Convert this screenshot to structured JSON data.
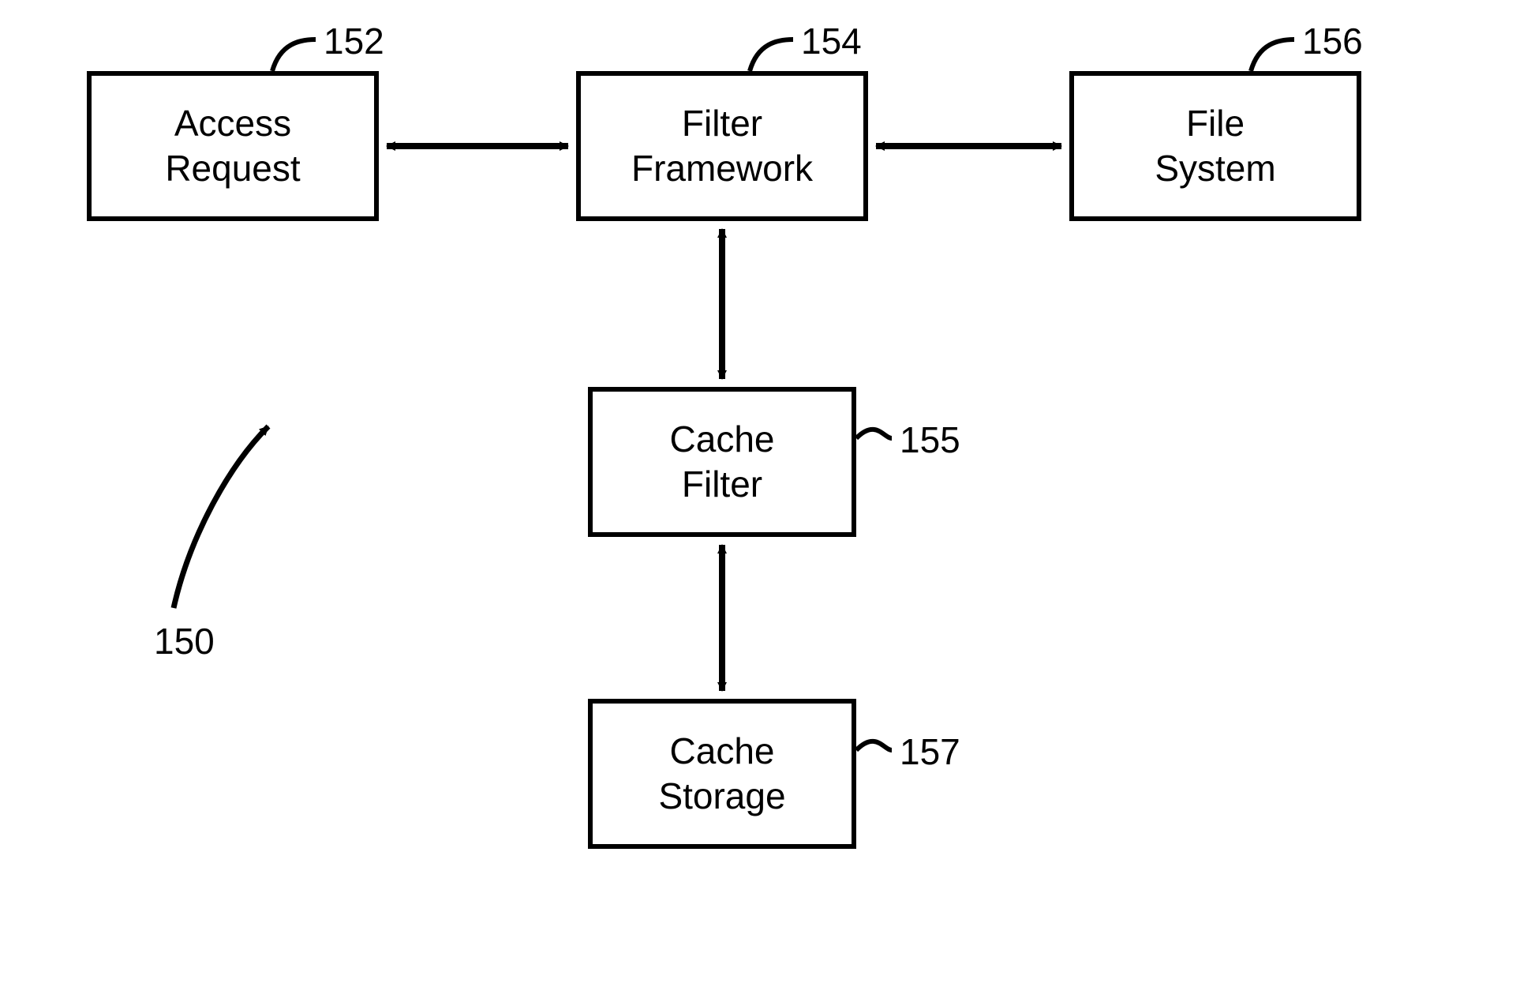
{
  "diagram": {
    "figure_ref": "150",
    "boxes": {
      "access_request": {
        "label": "Access\nRequest",
        "ref": "152"
      },
      "filter_framework": {
        "label": "Filter\nFramework",
        "ref": "154"
      },
      "file_system": {
        "label": "File\nSystem",
        "ref": "156"
      },
      "cache_filter": {
        "label": "Cache\nFilter",
        "ref": "155"
      },
      "cache_storage": {
        "label": "Cache\nStorage",
        "ref": "157"
      }
    },
    "connections": [
      {
        "from": "access_request",
        "to": "filter_framework",
        "bidirectional": true
      },
      {
        "from": "filter_framework",
        "to": "file_system",
        "bidirectional": true
      },
      {
        "from": "filter_framework",
        "to": "cache_filter",
        "bidirectional": true
      },
      {
        "from": "cache_filter",
        "to": "cache_storage",
        "bidirectional": true
      }
    ]
  }
}
